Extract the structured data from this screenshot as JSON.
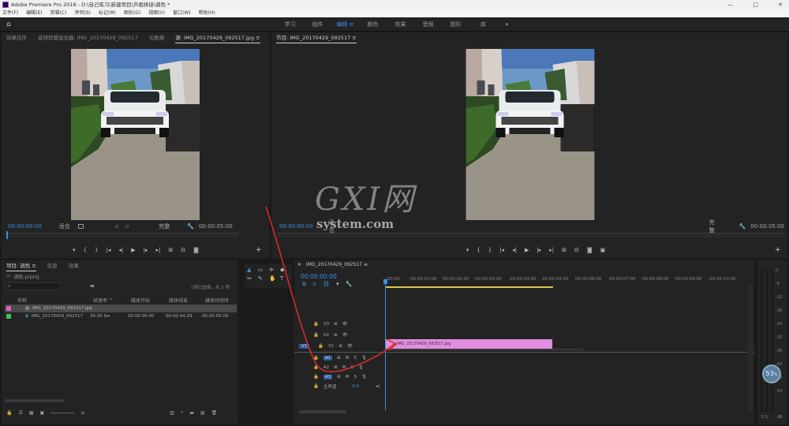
{
  "app": {
    "title": "Adobe Premiere Pro 2018 - D:\\自己练习\\新建项目\\声画拼接\\调色 *",
    "window_controls": [
      "—",
      "□",
      "✕"
    ]
  },
  "menu": [
    "文件(F)",
    "编辑(E)",
    "剪辑(C)",
    "序列(S)",
    "标记(M)",
    "图形(G)",
    "视图(V)",
    "窗口(W)",
    "帮助(H)"
  ],
  "workspace_tabs": [
    {
      "label": "学习",
      "active": false
    },
    {
      "label": "组件",
      "active": false
    },
    {
      "label": "编辑 ≡",
      "active": true
    },
    {
      "label": "颜色",
      "active": false
    },
    {
      "label": "效果",
      "active": false
    },
    {
      "label": "音频",
      "active": false
    },
    {
      "label": "图形",
      "active": false
    },
    {
      "label": "库",
      "active": false
    }
  ],
  "workspace_more": "»",
  "source_panel": {
    "tabs": [
      "效果控件",
      "音频剪辑混合器: IMG_20170429_092517",
      "元数据",
      "源: IMG_20170429_092517.jpg ≡"
    ],
    "timecode": "00:00:00:00",
    "fit": "适合",
    "quality": "完整",
    "duration": "00:00:05:00"
  },
  "program_panel": {
    "title": "节目: IMG_20170429_092517 ≡",
    "timecode": "00:00:00:00",
    "fit": "适合",
    "quality": "完整",
    "duration": "00:00:05:00"
  },
  "project_panel": {
    "tabs": [
      "项目: 调色 ≡",
      "信息",
      "效果"
    ],
    "project_file": "调色.prproj",
    "selection_status": "1项已选择，共 2 项",
    "columns": [
      "名称",
      "帧速率 ^",
      "媒体开始",
      "媒体结束",
      "媒体持续时"
    ],
    "rows": [
      {
        "name": "IMG_20170429_092517.jpg",
        "frame_rate": "",
        "start": "",
        "end": "",
        "duration": "",
        "color": "#e060c0",
        "selected": true
      },
      {
        "name": "IMG_20170429_092517",
        "frame_rate": "30.00 fps",
        "start": "00:00:00:00",
        "end": "00:00:04:29",
        "duration": "00:00:05:00",
        "color": "#40c060",
        "selected": false
      }
    ]
  },
  "timeline": {
    "title": "IMG_20170429_092517 ≡",
    "timecode": "00:00:00:00",
    "ruler": [
      ":00:00",
      "00:00:01:00",
      "00:00:02:00",
      "00:00:03:00",
      "00:00:04:00",
      "00:00:05:00",
      "00:00:06:00",
      "00:00:07:00",
      "00:00:08:00",
      "00:00:09:00",
      "00:00:10:00"
    ],
    "video_tracks": [
      "V3",
      "V2",
      "V1"
    ],
    "audio_tracks": [
      "A1",
      "A2",
      "A3"
    ],
    "master": "主声道",
    "master_value": "0.0",
    "clip_label": "IMG_20170429_092517.jpg",
    "clip_color": "#e28ee0",
    "source_patch": "V1"
  },
  "audio_meter": {
    "labels": [
      "0",
      "-6",
      "-12",
      "-18",
      "-24",
      "-30",
      "-36",
      "-42",
      "-48",
      "-54"
    ],
    "bottom": "dB",
    "bottom_letters": "S S"
  },
  "watermark": {
    "main": "GXI网",
    "sub": "system.com"
  },
  "badge": {
    "value": "53",
    "unit": "%"
  },
  "colors": {
    "accent_blue": "#3b8fe0",
    "playhead": "#3b8fe0",
    "annotation_red": "#d42a2a",
    "work_area_yellow": "#d8c84a"
  }
}
